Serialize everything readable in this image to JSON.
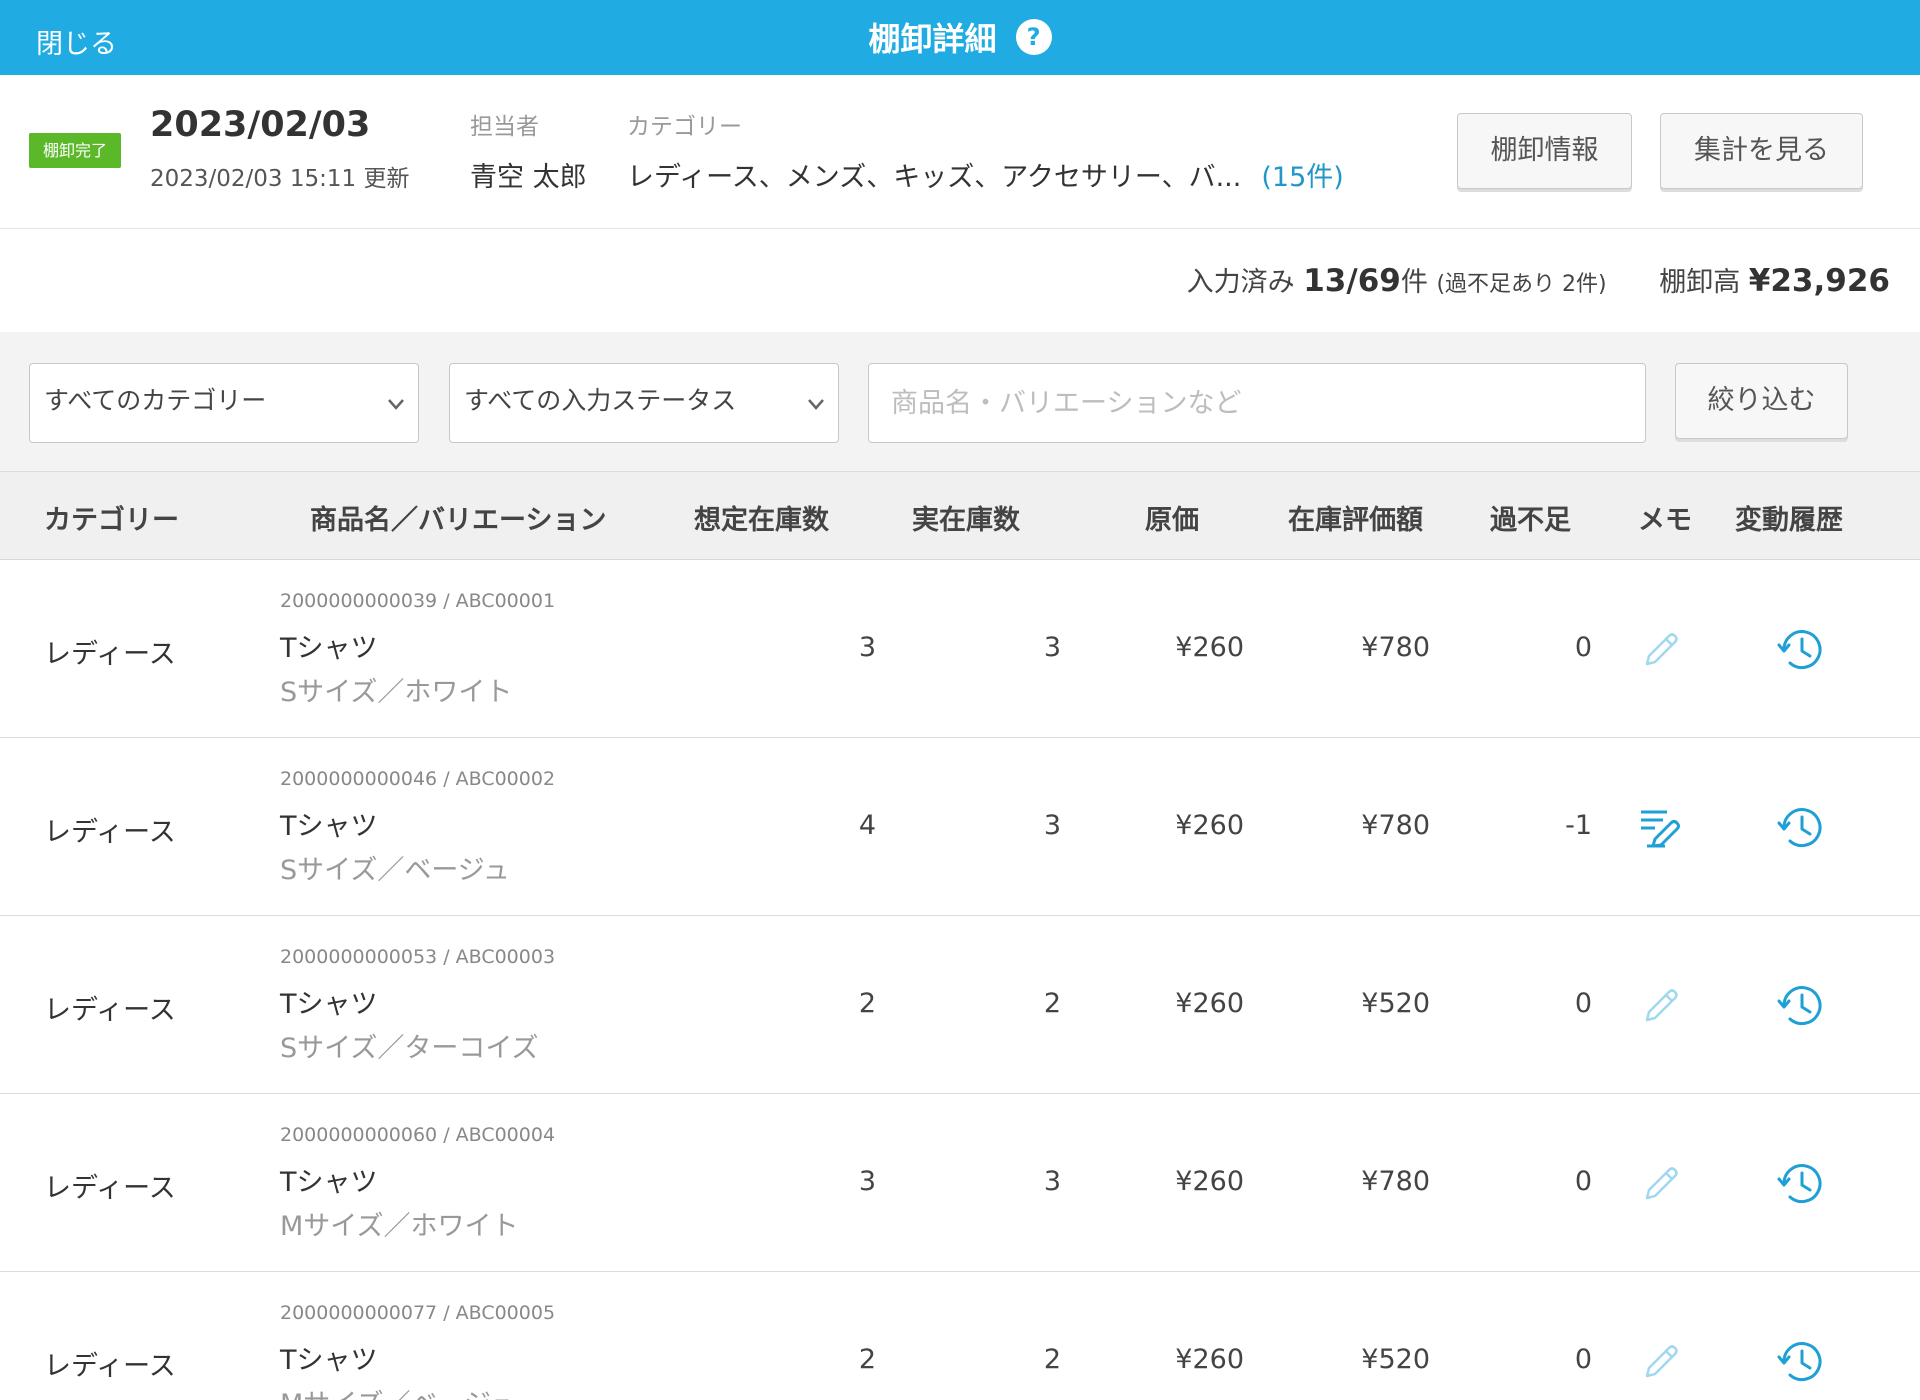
{
  "topbar": {
    "close_label": "閉じる",
    "title": "棚卸詳細",
    "help_icon_text": "?"
  },
  "info": {
    "status_badge": "棚卸完了",
    "date": "2023/02/03",
    "updated": "2023/02/03 15:11 更新",
    "assignee_label": "担当者",
    "assignee": "青空 太郎",
    "category_label": "カテゴリー",
    "categories": "レディース、メンズ、キッズ、アクセサリー、バ...",
    "category_count": "(15件)",
    "info_button": "棚卸情報",
    "summary_button": "集計を見る"
  },
  "summary": {
    "entered_label": "入力済み",
    "entered_value": "13/69",
    "entered_unit": "件",
    "shortage_note": "(過不足あり 2件)",
    "stock_label": "棚卸高",
    "stock_value": "¥23,926"
  },
  "filters": {
    "category_select": "すべてのカテゴリー",
    "status_select": "すべての入力ステータス",
    "search_placeholder": "商品名・バリエーションなど",
    "filter_button": "絞り込む"
  },
  "columns": [
    "カテゴリー",
    "商品名／バリエーション",
    "想定在庫数",
    "実在庫数",
    "原価",
    "在庫評価額",
    "過不足",
    "メモ",
    "変動履歴"
  ],
  "rows": [
    {
      "category": "レディース",
      "code": "2000000000039 / ABC00001",
      "name": "Tシャツ",
      "variant": "Sサイズ／ホワイト",
      "expected": "3",
      "actual": "3",
      "cost": "¥260",
      "value": "¥780",
      "diff": "0",
      "memo": "empty"
    },
    {
      "category": "レディース",
      "code": "2000000000046 / ABC00002",
      "name": "Tシャツ",
      "variant": "Sサイズ／ベージュ",
      "expected": "4",
      "actual": "3",
      "cost": "¥260",
      "value": "¥780",
      "diff": "-1",
      "memo": "filled"
    },
    {
      "category": "レディース",
      "code": "2000000000053 / ABC00003",
      "name": "Tシャツ",
      "variant": "Sサイズ／ターコイズ",
      "expected": "2",
      "actual": "2",
      "cost": "¥260",
      "value": "¥520",
      "diff": "0",
      "memo": "empty"
    },
    {
      "category": "レディース",
      "code": "2000000000060 / ABC00004",
      "name": "Tシャツ",
      "variant": "Mサイズ／ホワイト",
      "expected": "3",
      "actual": "3",
      "cost": "¥260",
      "value": "¥780",
      "diff": "0",
      "memo": "empty"
    },
    {
      "category": "レディース",
      "code": "2000000000077 / ABC00005",
      "name": "Tシャツ",
      "variant": "Mサイズ／ベージュ",
      "expected": "2",
      "actual": "2",
      "cost": "¥260",
      "value": "¥520",
      "diff": "0",
      "memo": "empty"
    }
  ],
  "icons": {
    "memo_empty": "pencil-icon",
    "memo_filled": "memo-pencil-icon",
    "history": "history-clock-icon",
    "dropdown": "chevron-down-icon"
  },
  "colors": {
    "brand": "#20ace2",
    "badge": "#5ab829",
    "link": "#2196c8",
    "icon_light": "#9fd8ef",
    "icon_dark": "#1e9fd6"
  }
}
